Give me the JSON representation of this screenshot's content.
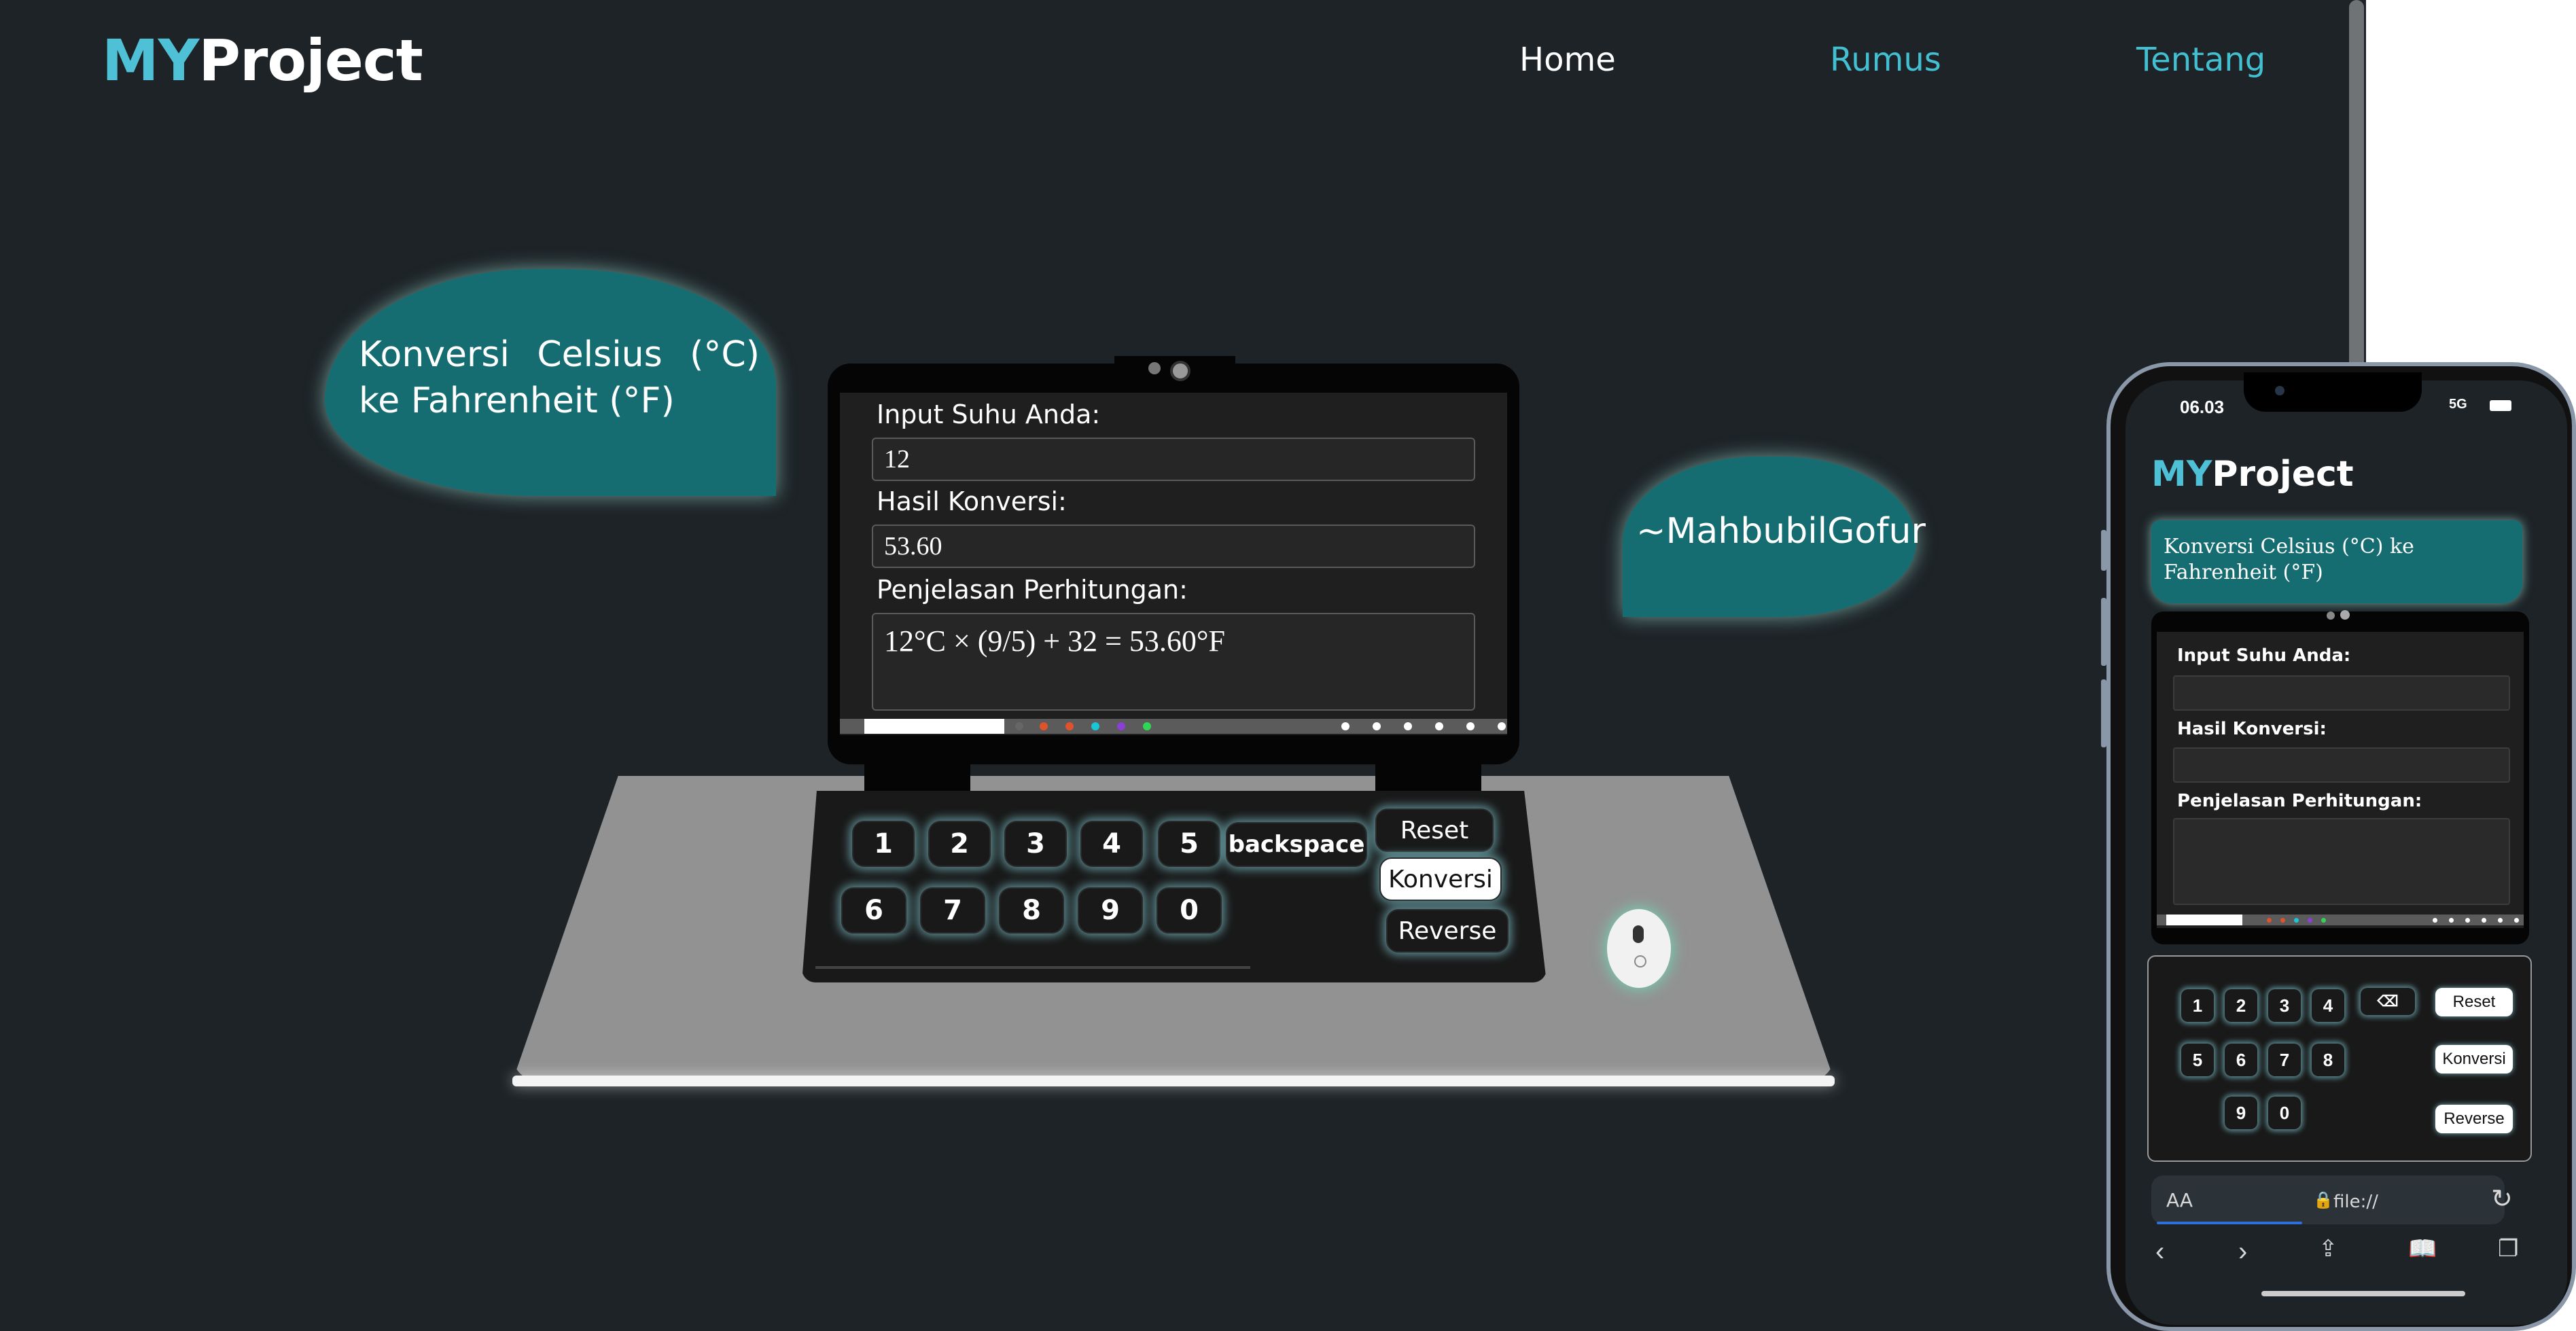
{
  "brand": {
    "prefix": "MY",
    "name": "Project"
  },
  "nav": {
    "home": "Home",
    "rumus": "Rumus",
    "tentang": "Tentang"
  },
  "bubbles": {
    "title": "Konversi Celsius (°C) ke Fahrenheit (°F)",
    "author": "~MahbubilGofur"
  },
  "form": {
    "input_label": "Input Suhu Anda:",
    "input_value": "12",
    "result_label": "Hasil Konversi:",
    "result_value": "53.60",
    "explain_label": "Penjelasan Perhitungan:",
    "explain_value": "12°C × (9/5) + 32 = 53.60°F"
  },
  "keypad": {
    "row1": [
      "1",
      "2",
      "3",
      "4",
      "5"
    ],
    "row2": [
      "6",
      "7",
      "8",
      "9",
      "0"
    ],
    "backspace": "backspace",
    "reset": "Reset",
    "convert": "Konversi",
    "reverse": "Reverse"
  },
  "colors": {
    "accent": "#4fc1d6",
    "bubble": "#156d72",
    "background": "#1d2327"
  },
  "mobile": {
    "time": "06.03",
    "network": "5G",
    "brand_prefix": "MY",
    "brand_name": "Project",
    "title": "Konversi Celsius (°C) ke Fahrenheit (°F)",
    "input_label": "Input Suhu Anda:",
    "result_label": "Hasil Konversi:",
    "explain_label": "Penjelasan Perhitungan:",
    "keys": [
      "1",
      "2",
      "3",
      "4",
      "5",
      "6",
      "7",
      "8",
      "9",
      "0"
    ],
    "reset": "Reset",
    "convert": "Konversi",
    "reverse": "Reverse",
    "aa": "AA",
    "url": "file://"
  }
}
